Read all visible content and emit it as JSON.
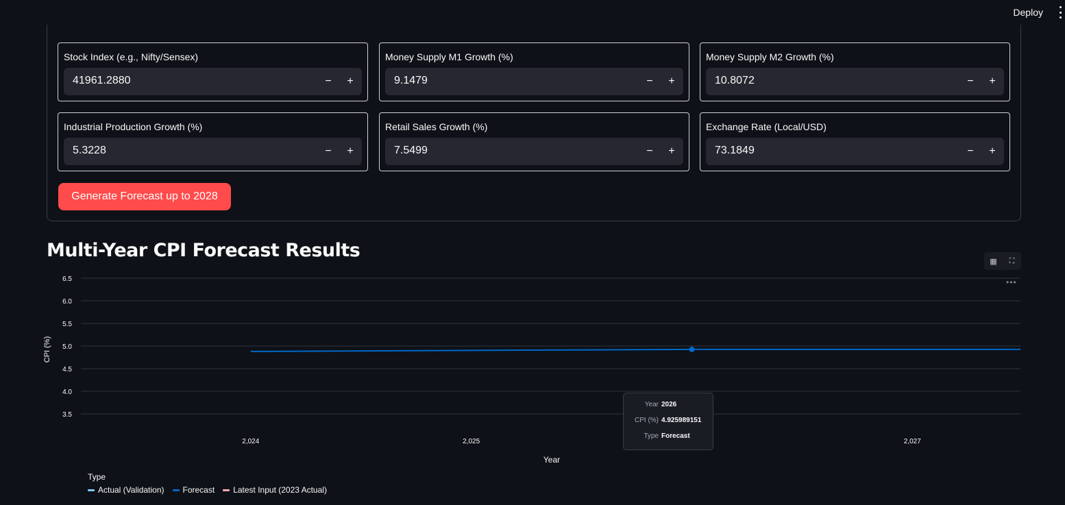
{
  "header": {
    "deploy_label": "Deploy",
    "menu_icon": "vertical-dots-icon"
  },
  "form": {
    "fields": [
      {
        "label": "Stock Index (e.g., Nifty/Sensex)",
        "value": "41961.2880"
      },
      {
        "label": "Money Supply M1 Growth (%)",
        "value": "9.1479"
      },
      {
        "label": "Money Supply M2 Growth (%)",
        "value": "10.8072"
      },
      {
        "label": "Industrial Production Growth (%)",
        "value": "5.3228"
      },
      {
        "label": "Retail Sales Growth (%)",
        "value": "7.5499"
      },
      {
        "label": "Exchange Rate (Local/USD)",
        "value": "73.1849"
      }
    ],
    "minus_symbol": "−",
    "plus_symbol": "+",
    "submit_label": "Generate Forecast up to 2028",
    "submit_color": "#ff4b4b"
  },
  "results": {
    "title": "Multi-Year CPI Forecast Results",
    "toolbar_icons": [
      "table-icon",
      "fullscreen-icon"
    ],
    "more_icon": "•••"
  },
  "tooltip": {
    "rows": [
      {
        "key": "Year",
        "value": "2026"
      },
      {
        "key": "CPI (%)",
        "value": "4.925989151"
      },
      {
        "key": "Type",
        "value": "Forecast"
      }
    ]
  },
  "chart_data": {
    "type": "line",
    "xlabel": "Year",
    "ylabel": "CPI (%)",
    "x_ticks": [
      "2,024",
      "2,025",
      "2,026",
      "2,027"
    ],
    "y_ticks": [
      "3.5",
      "4.0",
      "4.5",
      "5.0",
      "5.5",
      "6.0",
      "6.5"
    ],
    "xlim": [
      2023.23,
      2027.49
    ],
    "ylim": [
      3.5,
      6.5
    ],
    "grid": true,
    "legend_title": "Type",
    "legend_placement": "bottom-left",
    "series": [
      {
        "name": "Actual (Validation)",
        "color": "#83c9ff",
        "x": [],
        "y": []
      },
      {
        "name": "Forecast",
        "color": "#0068c9",
        "x": [
          2024,
          2026,
          2027.49
        ],
        "y": [
          4.88,
          4.925989151,
          4.925989151
        ]
      },
      {
        "name": "Latest Input (2023 Actual)",
        "color": "#ffabab",
        "x": [],
        "y": []
      }
    ],
    "highlight": {
      "x": 2026,
      "y": 4.925989151
    }
  }
}
